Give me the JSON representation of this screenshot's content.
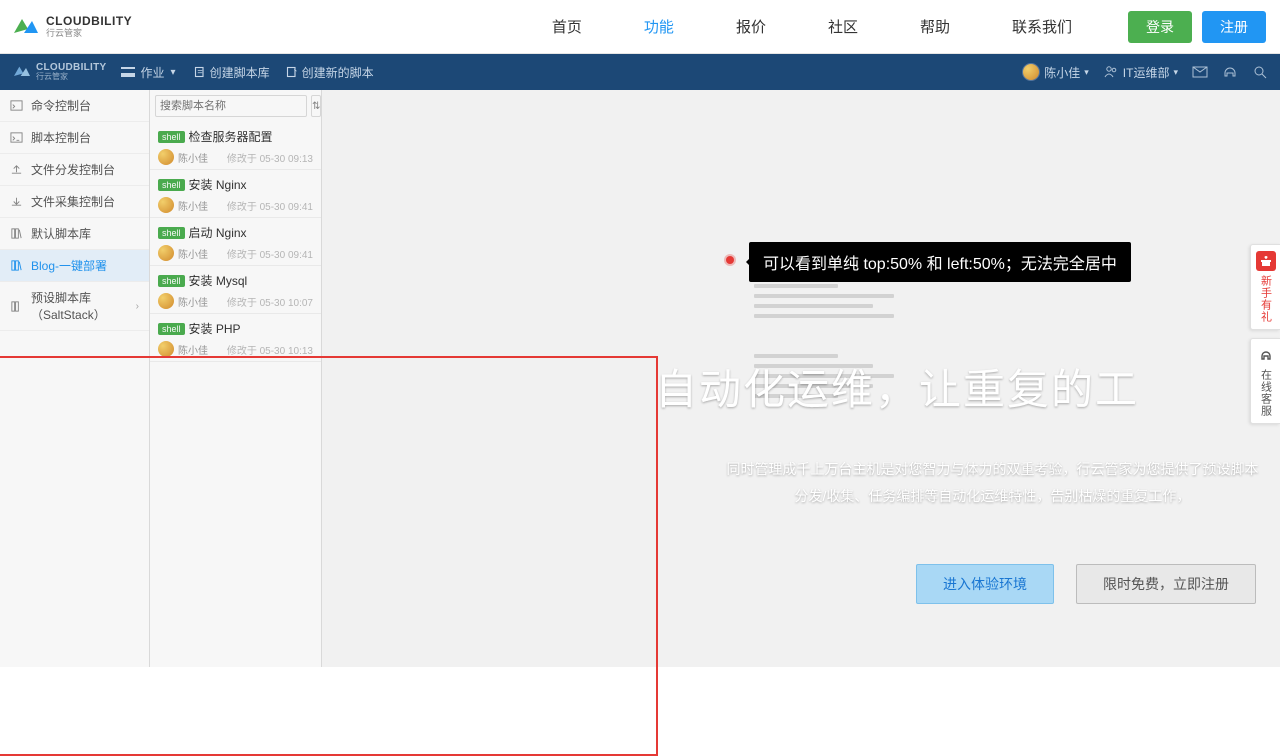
{
  "brand": {
    "en": "CLOUDBILITY",
    "cn": "行云管家"
  },
  "nav": {
    "items": [
      {
        "label": "首页",
        "active": false
      },
      {
        "label": "功能",
        "active": true
      },
      {
        "label": "报价",
        "active": false
      },
      {
        "label": "社区",
        "active": false
      },
      {
        "label": "帮助",
        "active": false
      },
      {
        "label": "联系我们",
        "active": false
      }
    ],
    "login": "登录",
    "register": "注册"
  },
  "app_header": {
    "crumb": "作业",
    "action_new_lib": "创建脚本库",
    "action_new_script": "创建新的脚本",
    "user_name": "陈小佳",
    "dept": "IT运维部"
  },
  "sidebar": {
    "items": [
      {
        "label": "命令控制台"
      },
      {
        "label": "脚本控制台"
      },
      {
        "label": "文件分发控制台"
      },
      {
        "label": "文件采集控制台"
      },
      {
        "label": "默认脚本库"
      },
      {
        "label": "Blog-一键部署",
        "active": true
      },
      {
        "label": "预设脚本库（SaltStack）",
        "caret": true
      }
    ]
  },
  "search": {
    "placeholder": "搜索脚本名称"
  },
  "scripts": [
    {
      "tag": "shell",
      "title": "检查服务器配置",
      "author": "陈小佳",
      "time": "修改于 05-30 09:13"
    },
    {
      "tag": "shell",
      "title": "安装 Nginx",
      "author": "陈小佳",
      "time": "修改于 05-30 09:41"
    },
    {
      "tag": "shell",
      "title": "启动 Nginx",
      "author": "陈小佳",
      "time": "修改于 05-30 09:41"
    },
    {
      "tag": "shell",
      "title": "安装 Mysql",
      "author": "陈小佳",
      "time": "修改于 05-30 10:07"
    },
    {
      "tag": "shell",
      "title": "安装 PHP",
      "author": "陈小佳",
      "time": "修改于 05-30 10:13"
    }
  ],
  "tooltip": "可以看到单纯 top:50% 和 left:50%；无法完全居中",
  "hero": {
    "title": "自动化运维，让重复的工",
    "sub_line1": "同时管理成千上万台主机是对您智力与体力的双重考验，行云管家为您提供了预设脚本",
    "sub_line2": "分发/收集、任务编排等自动化运维特性，告别枯燥的重复工作，",
    "btn_try": "进入体验环境",
    "btn_reg": "限时免费，立即注册"
  },
  "side_badges": {
    "gift": "新手有礼",
    "cs": "在线客服"
  }
}
